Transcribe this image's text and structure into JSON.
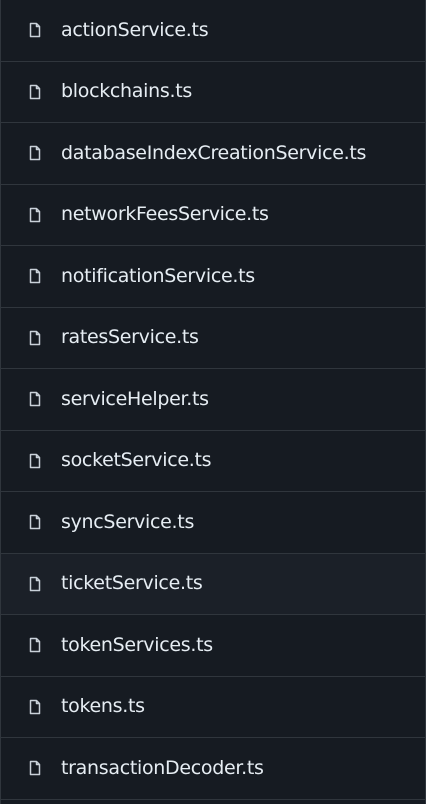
{
  "files": [
    {
      "name": "actionService.ts",
      "icon": "file-icon"
    },
    {
      "name": "blockchains.ts",
      "icon": "file-icon"
    },
    {
      "name": "databaseIndexCreationService.ts",
      "icon": "file-icon"
    },
    {
      "name": "networkFeesService.ts",
      "icon": "file-icon"
    },
    {
      "name": "notificationService.ts",
      "icon": "file-icon"
    },
    {
      "name": "ratesService.ts",
      "icon": "file-icon"
    },
    {
      "name": "serviceHelper.ts",
      "icon": "file-icon"
    },
    {
      "name": "socketService.ts",
      "icon": "file-icon"
    },
    {
      "name": "syncService.ts",
      "icon": "file-icon"
    },
    {
      "name": "ticketService.ts",
      "icon": "file-icon"
    },
    {
      "name": "tokenServices.ts",
      "icon": "file-icon"
    },
    {
      "name": "tokens.ts",
      "icon": "file-icon"
    },
    {
      "name": "transactionDecoder.ts",
      "icon": "file-icon"
    }
  ],
  "colors": {
    "background": "#161b22",
    "text": "#e6edf3",
    "icon": "#c9d1d9",
    "border": "#30363d"
  }
}
